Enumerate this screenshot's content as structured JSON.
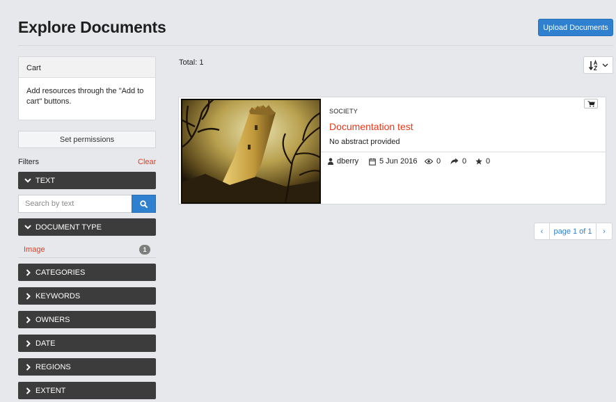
{
  "header": {
    "title": "Explore Documents",
    "upload_label": "Upload Documents"
  },
  "cart": {
    "title": "Cart",
    "message": "Add resources through the \"Add to cart\" buttons."
  },
  "set_permissions_label": "Set permissions",
  "filters": {
    "label": "Filters",
    "clear_label": "Clear",
    "text": {
      "label": "TEXT",
      "search_placeholder": "Search by text"
    },
    "document_type": {
      "label": "DOCUMENT TYPE",
      "items": [
        {
          "label": "Image",
          "count": "1"
        }
      ]
    },
    "collapsed": [
      {
        "label": "CATEGORIES"
      },
      {
        "label": "KEYWORDS"
      },
      {
        "label": "OWNERS"
      },
      {
        "label": "DATE"
      },
      {
        "label": "REGIONS"
      },
      {
        "label": "EXTENT"
      }
    ]
  },
  "results": {
    "total_text": "Total: 1",
    "items": [
      {
        "category": "SOCIETY",
        "title": "Documentation test",
        "abstract": "No abstract provided",
        "owner": "dberry",
        "date": "5 Jun 2016",
        "views": "0",
        "shares": "0",
        "rating": "0"
      }
    ]
  },
  "pagination": {
    "prev": "‹",
    "label": "page 1 of 1",
    "next": "›"
  },
  "colors": {
    "accent_blue": "#2f80cf",
    "accent_red": "#e8391a",
    "facet_dark": "#3c3c3c",
    "page_bg": "#e6e8eb"
  },
  "icons": {
    "upload": "none",
    "sort": "sort-alpha-icon",
    "search": "search-icon",
    "cart": "cart-icon",
    "owner": "user-icon",
    "date": "calendar-icon",
    "views": "eye-icon",
    "shares": "share-icon",
    "rating": "star-icon",
    "facet_open": "chevron-down-icon",
    "facet_closed": "chevron-right-icon"
  }
}
